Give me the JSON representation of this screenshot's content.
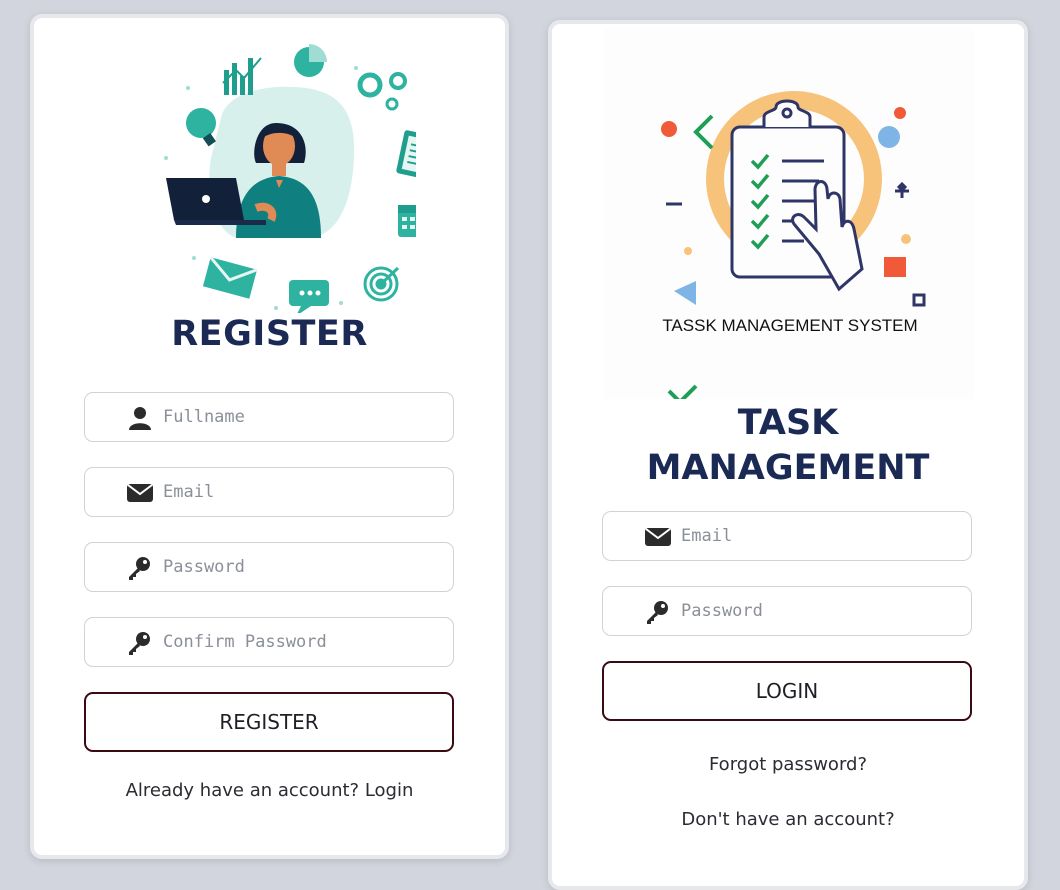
{
  "register": {
    "title": "REGISTER",
    "fields": [
      {
        "icon": "user-icon",
        "placeholder": "Fullname"
      },
      {
        "icon": "envelope-icon",
        "placeholder": "Email"
      },
      {
        "icon": "key-icon",
        "placeholder": "Password"
      },
      {
        "icon": "key-icon",
        "placeholder": "Confirm Password"
      }
    ],
    "button_label": "REGISTER",
    "footer_text": "Already have an account? Login"
  },
  "login": {
    "illustration_caption": "TASSK MANAGEMENT SYSTEM",
    "title_line1": "TASK",
    "title_line2": "MANAGEMENT",
    "fields": [
      {
        "icon": "envelope-icon",
        "placeholder": "Email"
      },
      {
        "icon": "key-icon",
        "placeholder": "Password"
      }
    ],
    "button_label": "LOGIN",
    "forgot_text": "Forgot password?",
    "signup_text": "Don't have an account?"
  },
  "colors": {
    "page_background": "#d2d5dd",
    "title": "#1b2a55",
    "button_border": "#3a0a12",
    "teal_accent": "#1f9e8e",
    "orange_accent": "#f7c27a"
  }
}
